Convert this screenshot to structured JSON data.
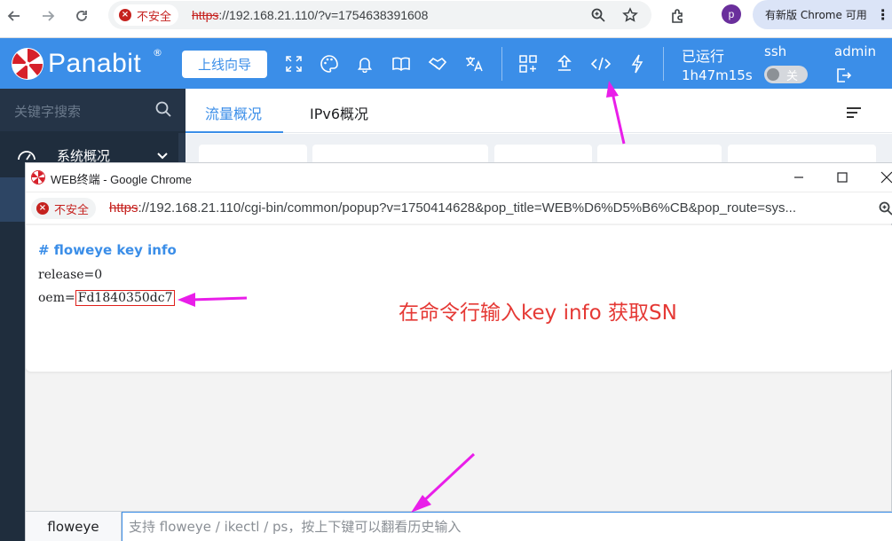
{
  "browser": {
    "security_label": "不安全",
    "url_scheme": "https",
    "url_rest": "://192.168.21.110/?v=1754638391608",
    "profile_initial": "p",
    "update_label": "有新版 Chrome 可用",
    "icons": [
      "back-icon",
      "forward-icon",
      "reload-icon",
      "zoom-icon",
      "star-icon",
      "extensions-icon",
      "more-icon"
    ]
  },
  "header": {
    "logo_text": "Panabit",
    "logo_mark": "®",
    "wizard_button": "上线向导",
    "uptime_label": "已运行",
    "uptime_value": "1h47m15s",
    "ssh_label": "ssh",
    "ssh_toggle": "关",
    "user_label": "admin",
    "icons": [
      "fullscreen-icon",
      "palette-icon",
      "bell-icon",
      "book-icon",
      "handshake-icon",
      "translate-icon",
      "apps-add-icon",
      "upload-icon",
      "code-icon",
      "bolt-icon",
      "logout-icon"
    ]
  },
  "sidebar": {
    "search_placeholder": "关键字搜索",
    "menu_item": "系统概况"
  },
  "tabs": [
    {
      "label": "流量概况",
      "active": true
    },
    {
      "label": "IPv6概况",
      "active": false
    }
  ],
  "popup": {
    "title": "WEB终端 - Google Chrome",
    "security_label": "不安全",
    "url_scheme": "https",
    "url_rest": "://192.168.21.110/cgi-bin/common/popup?v=1750414628&pop_title=WEB%D6%D5%B6%CB&pop_route=sys...",
    "command_title": "# floweye key info",
    "output": {
      "release_line": "release=0",
      "oem_prefix": "oem=",
      "oem_value": "Fd1840350dc7"
    },
    "annotation": "在命令行输入key info 获取SN",
    "cmd_prefix": "floweye",
    "cmd_placeholder": "支持 floweye / ikectl / ps，按上下键可以翻看历史输入"
  },
  "colors": {
    "brand_blue": "#3b8ee8",
    "sidebar_bg": "#1f2d3d",
    "annotation_red": "#e53935",
    "arrow_magenta": "#e91ee9"
  }
}
